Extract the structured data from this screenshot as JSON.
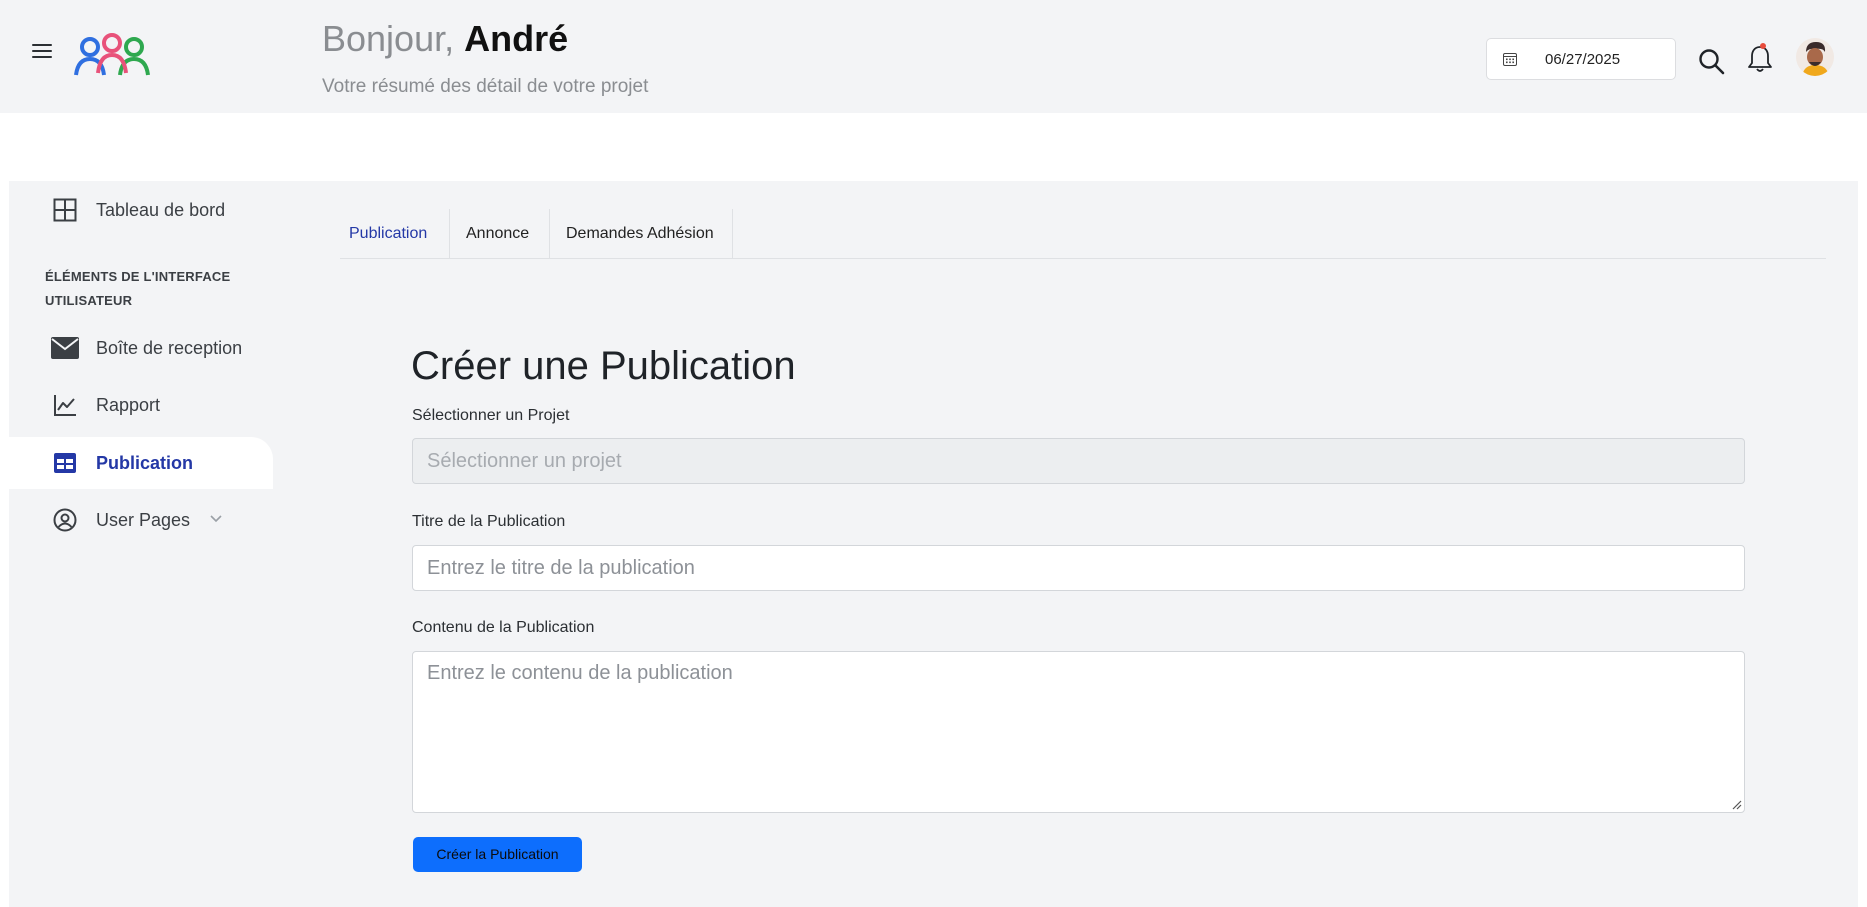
{
  "header": {
    "greeting_prefix": "Bonjour,",
    "user_name": "André",
    "subtitle": "Votre résumé des détail de votre projet",
    "date": "06/27/2025"
  },
  "sidebar": {
    "dashboard_label": "Tableau de bord",
    "section_label": "ÉLÉMENTS DE L'INTERFACE UTILISATEUR",
    "items": [
      {
        "label": "Boîte de reception",
        "icon": "envelope-icon"
      },
      {
        "label": "Rapport",
        "icon": "chart-line-icon"
      },
      {
        "label": "Publication",
        "icon": "table-icon",
        "active": true
      },
      {
        "label": "User Pages",
        "icon": "user-circle-icon"
      }
    ]
  },
  "tabs": [
    {
      "label": "Publication",
      "active": true
    },
    {
      "label": "Annonce"
    },
    {
      "label": "Demandes Adhésion"
    }
  ],
  "form": {
    "title": "Créer une Publication",
    "project_label": "Sélectionner un Projet",
    "project_placeholder": "Sélectionner un projet",
    "title_label": "Titre de la Publication",
    "title_placeholder": "Entrez le titre de la publication",
    "content_label": "Contenu de la Publication",
    "content_placeholder": "Entrez le contenu de la publication",
    "submit_label": "Créer la Publication"
  },
  "colors": {
    "accent": "#2438a6",
    "primary_button": "#0d6efd",
    "panel_bg": "#f3f4f6"
  }
}
